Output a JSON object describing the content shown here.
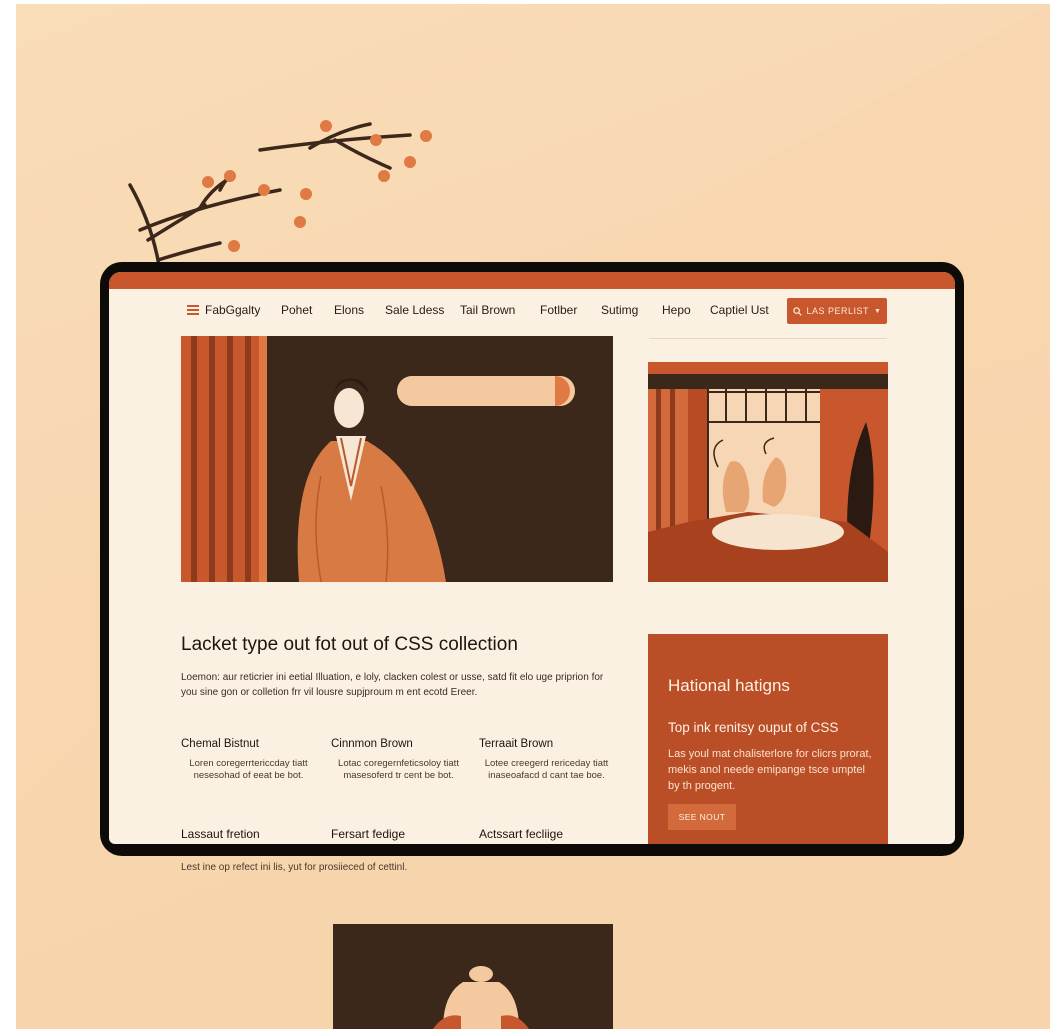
{
  "colors": {
    "background": "#f8d7b0",
    "accent": "#c9572e",
    "dark": "#3b281b",
    "screen": "#fbf1e3",
    "card": "#b94e27"
  },
  "nav": {
    "logo_icon": "hamburger-menu-icon",
    "logo": "FabGgalty",
    "items": [
      "Pohet",
      "Elons",
      "Sale Ldess",
      "Tail Brown",
      "Fotlber",
      "Sutimg",
      "Hepo",
      "Captiel Ust"
    ],
    "cta_label": "LAS PERLIST",
    "cta_icons": [
      "search-icon",
      "caret-down-icon"
    ]
  },
  "main": {
    "heading": "Lacket type out fot out of CSS collection",
    "lead": "Loemon: aur reticrier ini eetial Illuation, e loly, clacken colest or usse, satd fit elo uge priprion for you sine gon or colletion frr vil lousre supjproum m ent ecotd Ereer.",
    "columns": [
      {
        "title": "Chemal Bistnut",
        "text": "Loren coregerrtericcday tiatt nesesohad of eeat be bot."
      },
      {
        "title": "Cinnmon Brown",
        "text": "Lotac coregernfeticsoloy tiatt masesoferd tr cent be bot."
      },
      {
        "title": "Terraait Brown",
        "text": "Lotee creegerd rericeday tiatt inaseoafacd d cant tae boe."
      }
    ],
    "features": [
      "Lassaut fretion",
      "Fersart fedige",
      "Actssart fecliige"
    ]
  },
  "card": {
    "title": "Hational hatigns",
    "subtitle": "Top ink renitsy ouput of CSS",
    "text": "Las youl mat chalisterlore for clicrs prorat, mekis anol neede emipange tsce umptel by th progent.",
    "button": "SEE NOUT"
  },
  "below": {
    "text": "Lest ine op refect ini lis, yut for prosiieced of cettinl."
  }
}
